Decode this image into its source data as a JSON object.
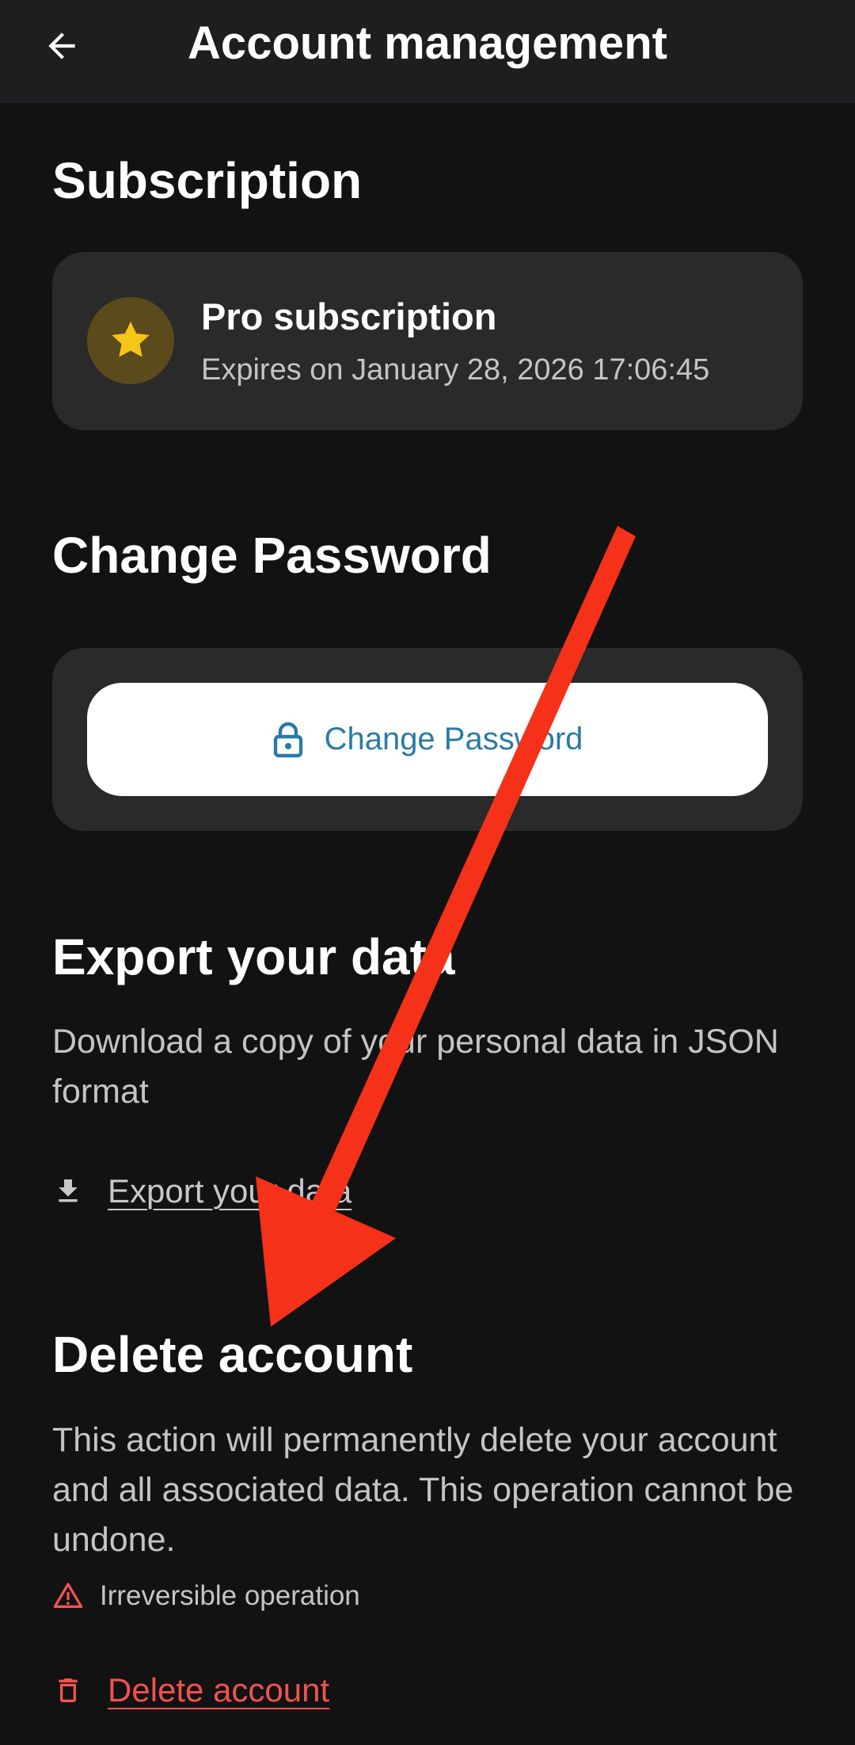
{
  "header": {
    "title": "Account management",
    "back_icon": "arrow-left-icon"
  },
  "subscription": {
    "section_title": "Subscription",
    "plan_name": "Pro subscription",
    "expiry": "Expires on January 28, 2026 17:06:45",
    "icon": "star-icon",
    "icon_color": "#f5c518"
  },
  "change_password": {
    "section_title": "Change Password",
    "button_label": "Change Password",
    "icon": "lock-icon"
  },
  "export": {
    "section_title": "Export your data",
    "description": "Download a copy of your personal data in JSON format",
    "link_label": "Export your data",
    "icon": "download-icon"
  },
  "delete": {
    "section_title": "Delete account",
    "description": "This action will permanently delete your account and all associated data. This operation cannot be undone.",
    "warning": "Irreversible operation",
    "warning_icon": "warning-triangle-icon",
    "link_label": "Delete account",
    "icon": "trash-icon",
    "danger_color": "#ef5350"
  },
  "annotation": {
    "arrow_color": "#f5311a"
  }
}
